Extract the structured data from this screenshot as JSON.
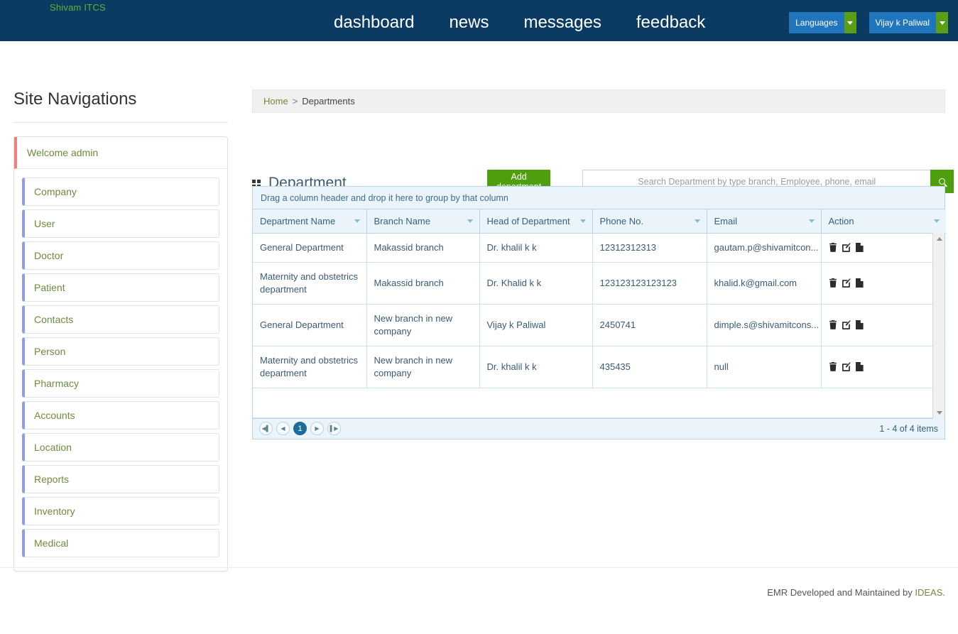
{
  "header": {
    "brand": "Shivam ITCS",
    "nav": [
      {
        "label": "dashboard"
      },
      {
        "label": "news"
      },
      {
        "label": "messages"
      },
      {
        "label": "feedback"
      }
    ],
    "languages_button": "Languages",
    "user_button": "Vijay k Paliwal"
  },
  "sidebar": {
    "title": "Site Navigations",
    "welcome": "Welcome admin",
    "items": [
      {
        "label": "Company"
      },
      {
        "label": "User"
      },
      {
        "label": "Doctor"
      },
      {
        "label": "Patient"
      },
      {
        "label": "Contacts"
      },
      {
        "label": "Person"
      },
      {
        "label": "Pharmacy"
      },
      {
        "label": "Accounts"
      },
      {
        "label": "Location"
      },
      {
        "label": "Reports"
      },
      {
        "label": "Inventory"
      },
      {
        "label": "Medical"
      }
    ]
  },
  "breadcrumb": {
    "home": "Home",
    "separator": ">",
    "current": "Departments"
  },
  "page": {
    "title": "Department",
    "add_button": "Add department",
    "search_placeholder": "Search Department by type branch, Employee, phone, email",
    "search_value": ""
  },
  "grid": {
    "group_hint": "Drag a column header and drop it here to group by that column",
    "columns": [
      "Department Name",
      "Branch Name",
      "Head of Department",
      "Phone No.",
      "Email",
      "Action"
    ],
    "rows": [
      {
        "department_name": "General Department",
        "branch_name": "Makassid branch",
        "head_of_department": "Dr. khalil k k",
        "phone": "12312312313",
        "email": "gautam.p@shivamitcon..."
      },
      {
        "department_name": "Maternity and obstetrics department",
        "branch_name": "Makassid branch",
        "head_of_department": "Dr. Khalid k k",
        "phone": "123123123123123",
        "email": "khalid.k@gmail.com"
      },
      {
        "department_name": "General Department",
        "branch_name": "New branch in new company",
        "head_of_department": "Vijay k Paliwal",
        "phone": "2450741",
        "email": "dimple.s@shivamitcons..."
      },
      {
        "department_name": "Maternity and obstetrics department",
        "branch_name": "New branch in new company",
        "head_of_department": "Dr. khalil k k",
        "phone": "435435",
        "email": "null"
      }
    ],
    "action_icons": [
      "delete-icon",
      "edit-icon",
      "document-icon"
    ],
    "pager": {
      "first": "first-page",
      "prev": "previous-page",
      "page": "1",
      "next": "next-page",
      "last": "last-page",
      "info": "1 - 4 of 4 items"
    }
  },
  "footer": {
    "text": "EMR Developed and Maintained by ",
    "link": "IDEAS",
    "suffix": "."
  },
  "colors": {
    "header_bg": "#0b3a63",
    "brand_green": "#5cb531",
    "accent_green": "#4f9e0e",
    "button_blue": "#2175bd",
    "grid_header": "#eaf4fa",
    "grid_border": "#b9d4e6",
    "welcome_accent": "#ef7f7f",
    "nav_accent": "#8d9ee8",
    "link_green": "#6d8b3c"
  }
}
